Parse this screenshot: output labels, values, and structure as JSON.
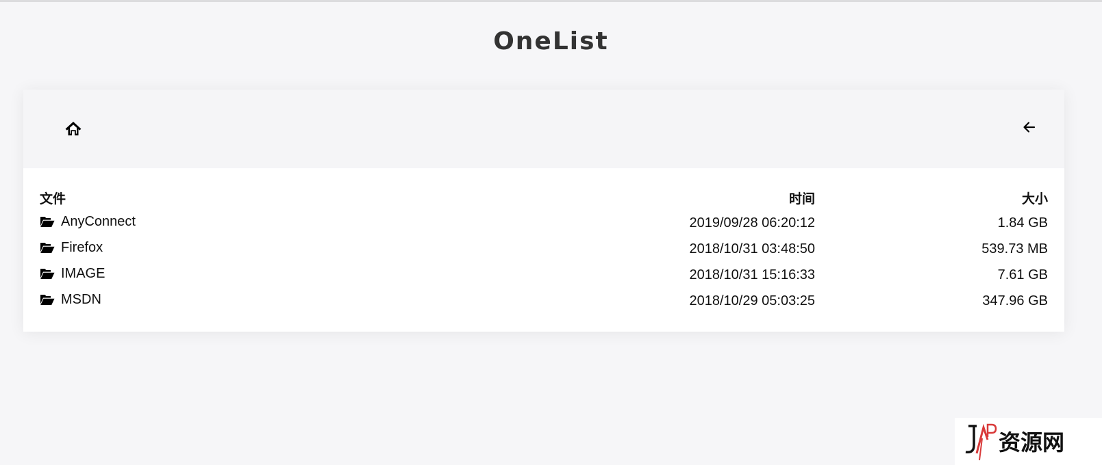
{
  "site": {
    "title": "OneList"
  },
  "toolbar": {
    "home_icon": "home-icon",
    "back_icon": "arrow-left-icon"
  },
  "table": {
    "headers": {
      "name": "文件",
      "time": "时间",
      "size": "大小"
    },
    "rows": [
      {
        "icon": "folder-open-icon",
        "name": "AnyConnect",
        "time": "2019/09/28 06:20:12",
        "size": "1.84 GB"
      },
      {
        "icon": "folder-open-icon",
        "name": "Firefox",
        "time": "2018/10/31 03:48:50",
        "size": "539.73 MB"
      },
      {
        "icon": "folder-open-icon",
        "name": "IMAGE",
        "time": "2018/10/31 15:16:33",
        "size": "7.61 GB"
      },
      {
        "icon": "folder-open-icon",
        "name": "MSDN",
        "time": "2018/10/29 05:03:25",
        "size": "347.96 GB"
      }
    ]
  },
  "watermark": {
    "text": "资源网"
  },
  "colors": {
    "background": "#f6f6f8",
    "card": "#ffffff",
    "toolbar": "#f5f5f7",
    "title": "#333333",
    "watermark_accent": "#d93a3a"
  }
}
